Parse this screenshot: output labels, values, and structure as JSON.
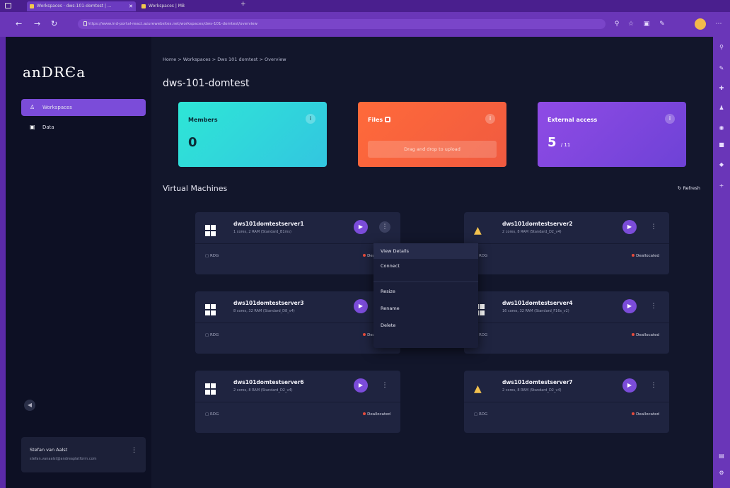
{
  "browser": {
    "tabs": [
      {
        "title": "Workspaces · dws-101-domtest | ..."
      },
      {
        "title": "Workspaces | MB"
      }
    ],
    "url": "https://www.ind-portal-react.azurewebsites.net/workspaces/dws-101-domtest/overview"
  },
  "sidebar": {
    "logo": "anDRЄa",
    "items": [
      {
        "label": "Workspaces"
      },
      {
        "label": "Data"
      }
    ],
    "user": {
      "name": "Stefan van Aalst",
      "email": "stefan.vanaalst@andreaplatform.com"
    }
  },
  "main": {
    "breadcrumb": "Home  >  Workspaces  >  Dws 101 domtest  >  Overview",
    "title": "dws-101-domtest",
    "stats": {
      "members": {
        "title": "Members",
        "value": "0"
      },
      "files": {
        "title": "Files",
        "upload_label": "Drag and drop to upload"
      },
      "external": {
        "title": "External access",
        "value": "5",
        "unit": "/ 11"
      }
    },
    "vm_section_title": "Virtual Machines",
    "refresh_label": "Refresh",
    "vms": [
      {
        "name": "dws101domtestserver1",
        "spec": "1 cores, 2 RAM (Standard_B1ms)",
        "rdp": "RDG",
        "status": "Deallocated"
      },
      {
        "name": "dws101domtestserver2",
        "spec": "2 cores, 8 RAM (Standard_D2_v4)",
        "rdp": "RDG",
        "status": "Deallocated"
      },
      {
        "name": "dws101domtestserver3",
        "spec": "8 cores, 32 RAM (Standard_D8_v4)",
        "rdp": "RDG",
        "status": "Deallocated"
      },
      {
        "name": "dws101domtestserver4",
        "spec": "16 cores, 32 RAM (Standard_F16s_v2)",
        "rdp": "RDG",
        "status": "Deallocated"
      },
      {
        "name": "dws101domtestserver6",
        "spec": "2 cores, 8 RAM (Standard_D2_v4)",
        "rdp": "RDG",
        "status": "Deallocated"
      },
      {
        "name": "dws101domtestserver7",
        "spec": "2 cores, 8 RAM (Standard_D2_v4)",
        "rdp": "RDG",
        "status": "Deallocated"
      }
    ],
    "context_menu": {
      "items": [
        {
          "label": "View Details"
        },
        {
          "label": "Connect"
        },
        {
          "label": "Resize"
        },
        {
          "label": "Rename"
        },
        {
          "label": "Delete"
        }
      ]
    }
  },
  "colors": {
    "accent": "#7b4cd9",
    "members_card": "#2ee6d6",
    "files_card": "#f05a40",
    "external_card": "#8f4be5",
    "status_deallocated": "#e74c3c"
  },
  "icons": {
    "windows": "windows-logo-icon",
    "linux": "linux-tux-icon",
    "play": "play-icon",
    "more": "more-vertical-icon"
  }
}
